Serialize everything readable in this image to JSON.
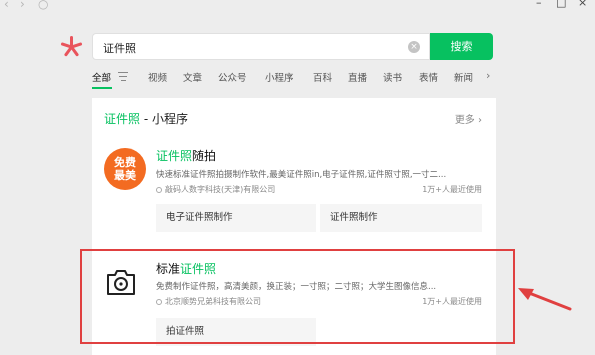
{
  "titlebar": {
    "back": "‹",
    "forward": "›",
    "refresh": "○",
    "minimize": "–",
    "maximize": "□",
    "close": "×"
  },
  "search": {
    "query": "证件照",
    "button_label": "搜索"
  },
  "tabs": [
    "全部",
    "视频",
    "文章",
    "公众号",
    "小程序",
    "百科",
    "直播",
    "读书",
    "表情",
    "新闻"
  ],
  "section": {
    "title_keyword": "证件照",
    "title_rest": " - 小程序",
    "more_label": "更多 ›"
  },
  "apps": [
    {
      "icon_text_1": "免费",
      "icon_text_2": "最美",
      "name_hl": "证件照",
      "name_rest": "随拍",
      "desc": "快速标准证件照拍摄制作软件,最美证件照in,电子证件照,证件照寸照,一寸二...",
      "company": "敲码人数字科技(天津)有限公司",
      "users": "1万+人最近使用",
      "services": [
        "电子证件照制作",
        "证件照制作"
      ]
    },
    {
      "name_pre": "标准",
      "name_hl": "证件照",
      "desc": "免费制作证件照，高清美颜，换正装；一寸照；二寸照；大学生图像信息...",
      "company": "北京顺势兄弟科技有限公司",
      "users": "1万+人最近使用",
      "services": [
        "拍证件照"
      ]
    }
  ],
  "colors": {
    "accent": "#07c160",
    "highlight": "#e04040",
    "icon_orange": "#f36b21"
  }
}
